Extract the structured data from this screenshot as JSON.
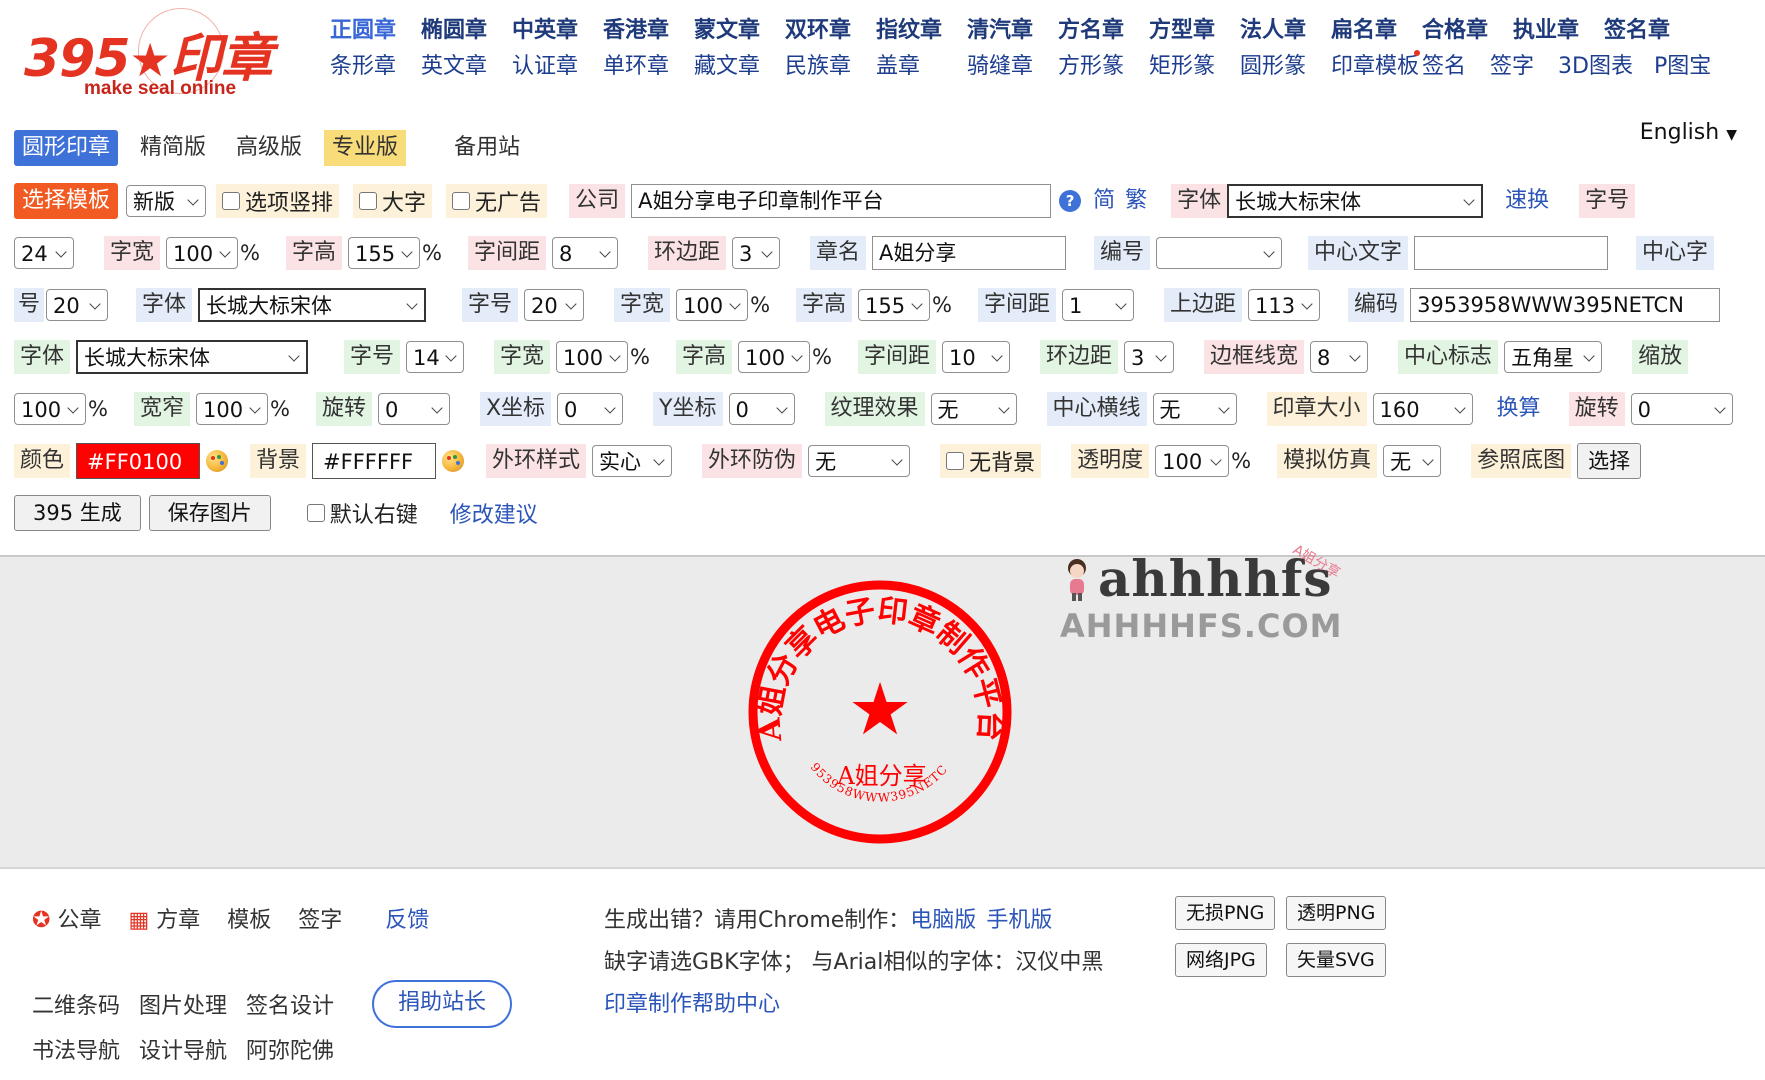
{
  "logo": {
    "text": "395",
    "star": "★",
    "word": "印章",
    "tagline": "make seal online"
  },
  "nav_primary": [
    "正圆章",
    "椭圆章",
    "中英章",
    "香港章",
    "蒙文章",
    "双环章",
    "指纹章",
    "清汽章",
    "方名章",
    "方型章",
    "法人章",
    "扁名章",
    "合格章",
    "执业章",
    "签名章"
  ],
  "nav_secondary": [
    "条形章",
    "英文章",
    "认证章",
    "单环章",
    "藏文章",
    "民族章",
    "盖章",
    "骑缝章",
    "方形篆",
    "矩形篆",
    "圆形篆",
    "印章模板",
    "签名",
    "签字",
    "3D图表",
    "P图宝"
  ],
  "tabs": {
    "round_seal": "圆形印章",
    "simple": "精简版",
    "advanced": "高级版",
    "pro": "专业版",
    "backup": "备用站"
  },
  "language": "English",
  "row1": {
    "select_template": "选择模板",
    "version": "新版",
    "chk_vertical": "选项竖排",
    "chk_big": "大字",
    "chk_noad": "无广告",
    "company_label": "公司",
    "company_value": "A姐分享电子印章制作平台",
    "simplified": "简",
    "traditional": "繁",
    "font_label": "字体",
    "font_value": "长城大标宋体",
    "quick": "速换",
    "size_label": "字号"
  },
  "row2": {
    "size_value": "24",
    "width_label": "字宽",
    "width_value": "100",
    "pct": "%",
    "height_label": "字高",
    "height_value": "155",
    "spacing_label": "字间距",
    "spacing_value": "8",
    "ring_label": "环边距",
    "ring_value": "3",
    "name_label": "章名",
    "name_value": "A姐分享",
    "code_label": "编号",
    "center_text_label": "中心文字",
    "center_char_label": "中心字"
  },
  "row3": {
    "hao": "号",
    "size_value": "20",
    "font_label": "字体",
    "font_value": "长城大标宋体",
    "size_label": "字号",
    "size2_value": "20",
    "width_label": "字宽",
    "width_value": "100",
    "height_label": "字高",
    "height_value": "155",
    "spacing_label": "字间距",
    "spacing_value": "1",
    "top_label": "上边距",
    "top_value": "113",
    "code_label": "编码",
    "code_value": "3953958WWW395NETCN"
  },
  "row4": {
    "font_label": "字体",
    "font_value": "长城大标宋体",
    "size_label": "字号",
    "size_value": "14",
    "width_label": "字宽",
    "width_value": "100",
    "height_label": "字高",
    "height_value": "100",
    "spacing_label": "字间距",
    "spacing_value": "10",
    "ring_label": "环边距",
    "ring_value": "3",
    "border_label": "边框线宽",
    "border_value": "8",
    "logo_label": "中心标志",
    "logo_value": "五角星",
    "scale_label": "缩放"
  },
  "row5": {
    "scale_value": "100",
    "narrow_label": "宽窄",
    "narrow_value": "100",
    "rotate_label": "旋转",
    "rotate_value": "0",
    "x_label": "X坐标",
    "x_value": "0",
    "y_label": "Y坐标",
    "y_value": "0",
    "texture_label": "纹理效果",
    "texture_value": "无",
    "hline_label": "中心横线",
    "hline_value": "无",
    "seal_size_label": "印章大小",
    "seal_size_value": "160",
    "convert": "换算",
    "rotate2_label": "旋转",
    "rotate2_value": "0"
  },
  "row6": {
    "color_label": "颜色",
    "color_value": "#FF0100",
    "bg_label": "背景",
    "bg_value": "#FFFFFF",
    "outer_style_label": "外环样式",
    "outer_style_value": "实心",
    "outer_guard_label": "外环防伪",
    "outer_guard_value": "无",
    "chk_nobg": "无背景",
    "opacity_label": "透明度",
    "opacity_value": "100",
    "sim_label": "模拟仿真",
    "sim_value": "无",
    "ref_label": "参照底图",
    "choose": "选择"
  },
  "row7": {
    "generate": "395 生成",
    "save": "保存图片",
    "chk_rightkey": "默认右键",
    "suggest": "修改建议"
  },
  "colors": {
    "seal_red": "#FF0100",
    "accent_blue": "#3f72d8",
    "orange": "#f15a22"
  },
  "seal": {
    "arc_text": "A姐分享电子印章制作平台",
    "name": "A姐分享",
    "code": "3953958WWW395NETCN",
    "center": "★"
  },
  "watermark": {
    "name": "ahhhhfs",
    "domain": "AHHHHFS.COM",
    "tiny": "A姐分享"
  },
  "footer": {
    "gongzhang": "公章",
    "fangzhang": "方章",
    "moban": "模板",
    "qianzi": "签字",
    "fankui": "反馈",
    "erweima": "二维条码",
    "tupian": "图片处理",
    "qianming": "签名设计",
    "shufa": "书法导航",
    "sheji": "设计导航",
    "amituofo": "阿弥陀佛",
    "donate": "捐助站长",
    "line1_prefix": "生成出错？请用Chrome制作：",
    "pc": "电脑版",
    "mobile": "手机版",
    "line2": "缺字请选GBK字体；  与Arial相似的字体：汉仪中黑",
    "help": "印章制作帮助中心",
    "png_lossless": "无损PNG",
    "png_transparent": "透明PNG",
    "jpg": "网络JPG",
    "svg": "矢量SVG"
  }
}
